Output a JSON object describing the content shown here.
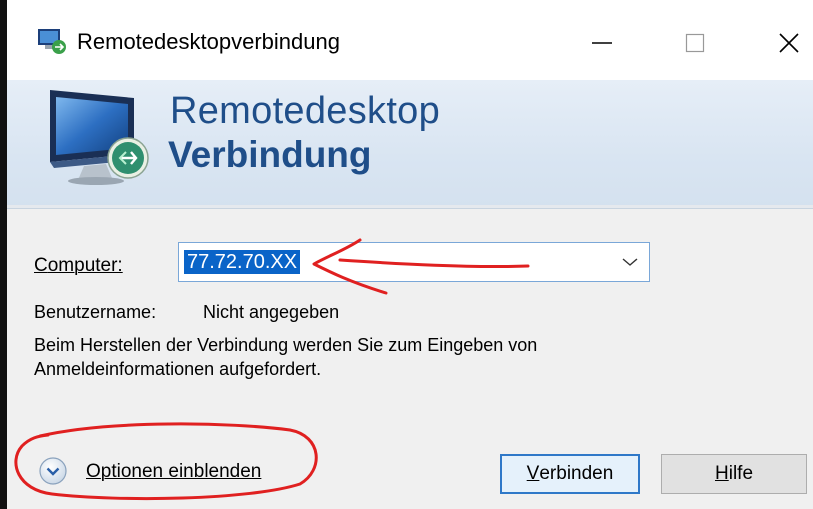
{
  "window": {
    "title": "Remotedesktopverbindung",
    "controls": [
      "minimize",
      "maximize",
      "close"
    ]
  },
  "banner": {
    "line1": "Remotedesktop",
    "line2": "Verbindung"
  },
  "form": {
    "computer_label_u": "C",
    "computer_label_rest": "omputer:",
    "computer_value": "77.72.70.XX",
    "username_label": "Benutzername:",
    "username_value": "Nicht angegeben",
    "info_line1": "Beim Herstellen der Verbindung werden Sie zum Eingeben von",
    "info_line2": "Anmeldeinformationen aufgefordert."
  },
  "footer": {
    "options_u": "O",
    "options_rest": "ptionen einblenden",
    "connect_u": "V",
    "connect_rest": "erbinden",
    "help_u": "H",
    "help_rest": "ilfe"
  },
  "colors": {
    "banner_text": "#1f4e89",
    "selection": "#0a64c8",
    "annotation": "#e02020"
  },
  "icons": {
    "app": "remote-desktop-app-icon",
    "banner": "remote-desktop-monitor-icon",
    "options": "chevron-down-circle-icon",
    "combo": "chevron-down-icon"
  }
}
